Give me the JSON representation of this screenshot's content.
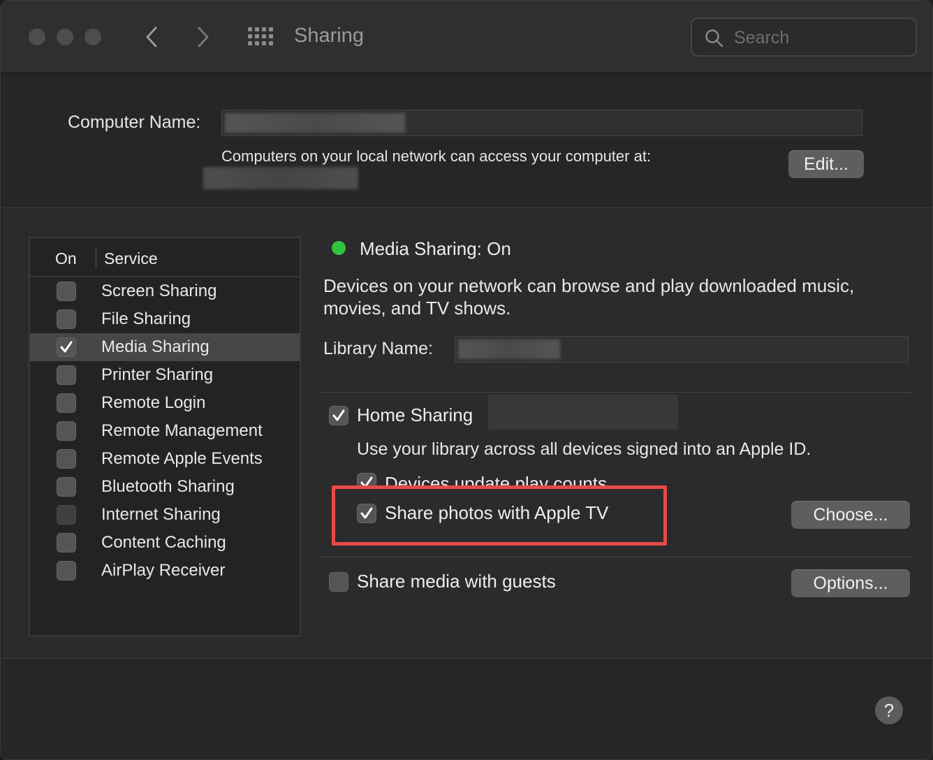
{
  "window": {
    "title": "Sharing"
  },
  "search": {
    "placeholder": "Search"
  },
  "header": {
    "computer_name_label": "Computer Name:",
    "access_text": "Computers on your local network can access your computer at:",
    "edit_button": "Edit..."
  },
  "service_list": {
    "col_on": "On",
    "col_service": "Service",
    "items": [
      {
        "label": "Screen Sharing",
        "checked": false
      },
      {
        "label": "File Sharing",
        "checked": false
      },
      {
        "label": "Media Sharing",
        "checked": true,
        "selected": true
      },
      {
        "label": "Printer Sharing",
        "checked": false
      },
      {
        "label": "Remote Login",
        "checked": false
      },
      {
        "label": "Remote Management",
        "checked": false
      },
      {
        "label": "Remote Apple Events",
        "checked": false
      },
      {
        "label": "Bluetooth Sharing",
        "checked": false
      },
      {
        "label": "Internet Sharing",
        "checked": false,
        "disabled": true
      },
      {
        "label": "Content Caching",
        "checked": false
      },
      {
        "label": "AirPlay Receiver",
        "checked": false
      }
    ]
  },
  "detail": {
    "status": "Media Sharing: On",
    "status_color": "#2ec43e",
    "description": "Devices on your network can browse and play downloaded music, movies, and TV shows.",
    "library_name_label": "Library Name:",
    "home_sharing": {
      "label": "Home Sharing",
      "checked": true
    },
    "home_sharing_desc": "Use your library across all devices signed into an Apple ID.",
    "update_play_counts": {
      "label": "Devices update play counts",
      "checked": true
    },
    "share_photos": {
      "label": "Share photos with Apple TV",
      "checked": true
    },
    "choose_button": "Choose...",
    "share_guests": {
      "label": "Share media with guests",
      "checked": false
    },
    "options_button": "Options..."
  },
  "highlight_color": "#e8494a",
  "help_label": "?"
}
